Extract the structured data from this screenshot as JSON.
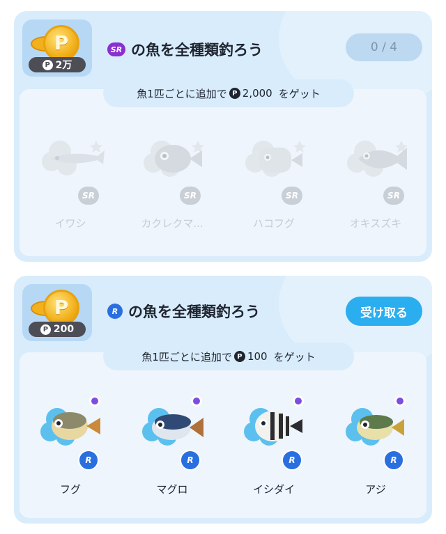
{
  "colors": {
    "card_bg": "#d9ecfb",
    "inner_bg": "#eef5fd",
    "claim_button": "#2aaef0",
    "sr_badge_active": "#8a2fd0",
    "r_badge": "#2a6fe0",
    "locked_gray": "#c9cfd6"
  },
  "sections": [
    {
      "reward_label": "2万",
      "rarity_icon": "SR",
      "title": "の魚を全種類釣ろう",
      "status_label": "0 / 4",
      "subtitle_prefix": "魚1匹ごとに追加で",
      "subtitle_amount": "2,000",
      "subtitle_suffix": "をゲット",
      "fish": [
        {
          "name": "イワシ",
          "badge": "SR",
          "locked": true
        },
        {
          "name": "カクレクマ...",
          "badge": "SR",
          "locked": true
        },
        {
          "name": "ハコフグ",
          "badge": "SR",
          "locked": true
        },
        {
          "name": "オキスズキ",
          "badge": "SR",
          "locked": true
        }
      ]
    },
    {
      "reward_label": "200",
      "rarity_icon": "R",
      "title": "の魚を全種類釣ろう",
      "button_label": "受け取る",
      "subtitle_prefix": "魚1匹ごとに追加で",
      "subtitle_amount": "100",
      "subtitle_suffix": "をゲット",
      "fish": [
        {
          "name": "フグ",
          "badge": "R",
          "locked": false
        },
        {
          "name": "マグロ",
          "badge": "R",
          "locked": false
        },
        {
          "name": "イシダイ",
          "badge": "R",
          "locked": false
        },
        {
          "name": "アジ",
          "badge": "R",
          "locked": false
        }
      ]
    }
  ],
  "icons": {
    "coin": "coin-p-icon",
    "point": "point-p-icon",
    "new_dot": "new-dot-icon"
  }
}
